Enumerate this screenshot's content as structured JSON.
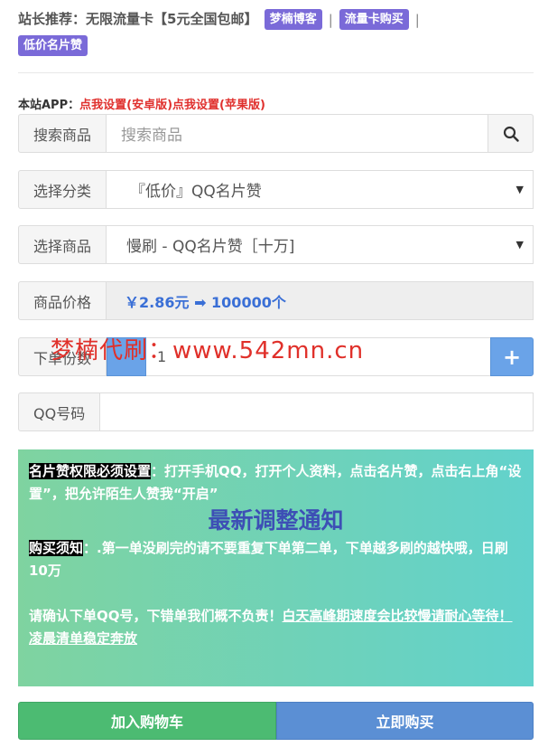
{
  "header": {
    "intro": "站长推荐：无限流量卡【5元全国包邮】",
    "tags": [
      "梦楠博客",
      "流量卡购买",
      "低价名片赞"
    ],
    "separator": "|"
  },
  "app": {
    "label": "本站APP：",
    "android": "点我设置(安卓版)",
    "apple": "点我设置(苹果版)"
  },
  "search": {
    "label": "搜索商品",
    "placeholder": "搜索商品"
  },
  "category": {
    "label": "选择分类",
    "value": "『低价』QQ名片赞"
  },
  "product": {
    "label": "选择商品",
    "value": "慢刷 - QQ名片赞［十万]"
  },
  "price": {
    "label": "商品价格",
    "value": "￥2.86元 ➡ 100000个"
  },
  "quantity": {
    "label": "下单份数",
    "value": "1",
    "plus": "+"
  },
  "qq": {
    "label": "QQ号码"
  },
  "watermark": "梦楠代刷：www.542mn.cn",
  "notice": {
    "p1_hl": "名片赞权限必须设置",
    "p1_text": "：打开手机QQ，打开个人资料，点击名片赞，点击右上角“设置”，把允许陌生人赞我“开启”",
    "title": "最新调整通知",
    "p2_hl": "购买须知",
    "p2_text": "：.第一单没刷完的请不要重复下单第二单，下单越多刷的越快哦，日刷10万",
    "p3_text": "请确认下单QQ号，下错单我们概不负责！",
    "p3_under": "白天高峰期速度会比较慢请耐心等待！凌晨清单稳定奔放"
  },
  "actions": {
    "cart": "加入购物车",
    "buy": "立即购买"
  },
  "colors": {
    "tag": "#7a6ad8",
    "link_red": "#e0312e",
    "price_blue": "#3a6fd6",
    "cart_green": "#4cbb72",
    "buy_blue": "#5b8fd4"
  }
}
